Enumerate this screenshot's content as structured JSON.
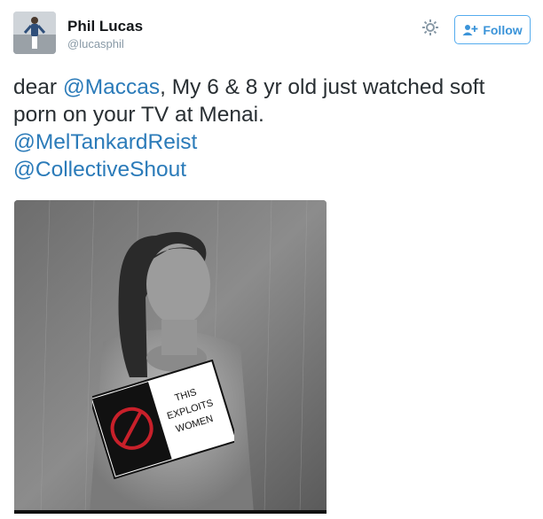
{
  "user": {
    "name": "Phil Lucas",
    "handle": "@lucasphil"
  },
  "actions": {
    "settings_icon": "gear-icon",
    "follow_label": "Follow",
    "follow_icon": "person-plus-icon"
  },
  "tweet": {
    "line1_prefix": "dear ",
    "mention_maccas": "@Maccas",
    "line1_suffix": ", My 6 & 8 yr old just watched soft",
    "line2": "porn on your TV at Menai.",
    "mention_mel": "@MelTankardReist",
    "mention_collective": "@CollectiveShout"
  },
  "media": {
    "sign_line1": "THIS",
    "sign_line2": "EXPLOITS",
    "sign_line3": "WOMEN"
  },
  "colors": {
    "mention": "#2b7bb9",
    "follow_border": "#55acee",
    "follow_text": "#3b94d9",
    "sign_red": "#c8202a"
  }
}
